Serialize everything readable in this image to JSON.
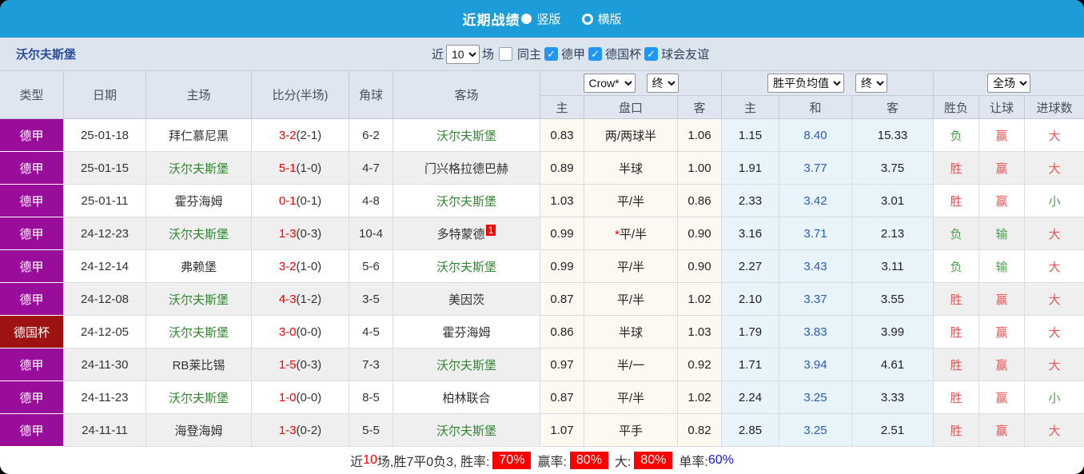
{
  "colors": {
    "accent_blue": "#1c9cd8",
    "league_purple": "#990d9b",
    "cup_red": "#9e1212",
    "win_red": "#f15353",
    "lose_green": "#4ca04c",
    "self_team_green": "#308830",
    "score_red": "#ff0000",
    "avg_draw_blue": "#2a5db8",
    "team_link_blue": "#2b4d9e",
    "rate_badge_red": "#ff0000",
    "single_rate_blue": "#1414e6"
  },
  "topbar": {
    "title": "近期战绩",
    "vertical_label": "竖版",
    "horizontal_label": "横版",
    "selected_layout": "竖版"
  },
  "filterbar": {
    "team": "沃尔夫斯堡",
    "near_label": "近",
    "count": "10",
    "games_label": "场",
    "same_home_label": "同主",
    "leagues": [
      "德甲",
      "德国杯",
      "球会友谊"
    ],
    "check_icon": "✓"
  },
  "table": {
    "selects": {
      "odds_source": "Crow*",
      "odds_time": "终",
      "avg_type": "胜平负均值",
      "avg_time": "终",
      "scope": "全场"
    },
    "columns": [
      "类型",
      "日期",
      "主场",
      "比分(半场)",
      "角球",
      "客场"
    ],
    "subcolumns": [
      "主",
      "盘口",
      "客",
      "主",
      "和",
      "客",
      "胜负",
      "让球",
      "进球数"
    ],
    "rows": [
      {
        "type": "德甲",
        "kind": "league",
        "date": "25-01-18",
        "home": {
          "text": "拜仁慕尼黑",
          "self": false
        },
        "score": "3-2",
        "half": "(2-1)",
        "corners": "6-2",
        "away": {
          "text": "沃尔夫斯堡",
          "self": true,
          "badge": ""
        },
        "odds": {
          "home": "0.83",
          "handicap": "两/两球半",
          "mark": "",
          "away": "1.06"
        },
        "avg": {
          "home": "1.15",
          "draw": "8.40",
          "away": "15.33"
        },
        "outcomes": [
          {
            "text": "负",
            "tone": "green"
          },
          {
            "text": "赢",
            "tone": "red"
          },
          {
            "text": "大",
            "tone": "red"
          }
        ]
      },
      {
        "type": "德甲",
        "kind": "league",
        "date": "25-01-15",
        "home": {
          "text": "沃尔夫斯堡",
          "self": true
        },
        "score": "5-1",
        "half": "(1-0)",
        "corners": "4-7",
        "away": {
          "text": "门兴格拉德巴赫",
          "self": false,
          "badge": ""
        },
        "odds": {
          "home": "0.89",
          "handicap": "半球",
          "mark": "",
          "away": "1.00"
        },
        "avg": {
          "home": "1.91",
          "draw": "3.77",
          "away": "3.75"
        },
        "outcomes": [
          {
            "text": "胜",
            "tone": "red"
          },
          {
            "text": "赢",
            "tone": "red"
          },
          {
            "text": "大",
            "tone": "red"
          }
        ]
      },
      {
        "type": "德甲",
        "kind": "league",
        "date": "25-01-11",
        "home": {
          "text": "霍芬海姆",
          "self": false
        },
        "score": "0-1",
        "half": "(0-1)",
        "corners": "4-8",
        "away": {
          "text": "沃尔夫斯堡",
          "self": true,
          "badge": ""
        },
        "odds": {
          "home": "1.03",
          "handicap": "平/半",
          "mark": "",
          "away": "0.86"
        },
        "avg": {
          "home": "2.33",
          "draw": "3.42",
          "away": "3.01"
        },
        "outcomes": [
          {
            "text": "胜",
            "tone": "red"
          },
          {
            "text": "赢",
            "tone": "red"
          },
          {
            "text": "小",
            "tone": "green"
          }
        ]
      },
      {
        "type": "德甲",
        "kind": "league",
        "date": "24-12-23",
        "home": {
          "text": "沃尔夫斯堡",
          "self": true
        },
        "score": "1-3",
        "half": "(0-3)",
        "corners": "10-4",
        "away": {
          "text": "多特蒙德",
          "self": false,
          "badge": "1"
        },
        "odds": {
          "home": "0.99",
          "handicap": "平/半",
          "mark": "*",
          "away": "0.90"
        },
        "avg": {
          "home": "3.16",
          "draw": "3.71",
          "away": "2.13"
        },
        "outcomes": [
          {
            "text": "负",
            "tone": "green"
          },
          {
            "text": "输",
            "tone": "green"
          },
          {
            "text": "大",
            "tone": "red"
          }
        ]
      },
      {
        "type": "德甲",
        "kind": "league",
        "date": "24-12-14",
        "home": {
          "text": "弗赖堡",
          "self": false
        },
        "score": "3-2",
        "half": "(1-0)",
        "corners": "5-6",
        "away": {
          "text": "沃尔夫斯堡",
          "self": true,
          "badge": ""
        },
        "odds": {
          "home": "0.99",
          "handicap": "平/半",
          "mark": "",
          "away": "0.90"
        },
        "avg": {
          "home": "2.27",
          "draw": "3.43",
          "away": "3.11"
        },
        "outcomes": [
          {
            "text": "负",
            "tone": "green"
          },
          {
            "text": "输",
            "tone": "green"
          },
          {
            "text": "大",
            "tone": "red"
          }
        ]
      },
      {
        "type": "德甲",
        "kind": "league",
        "date": "24-12-08",
        "home": {
          "text": "沃尔夫斯堡",
          "self": true
        },
        "score": "4-3",
        "half": "(1-2)",
        "corners": "3-5",
        "away": {
          "text": "美因茨",
          "self": false,
          "badge": ""
        },
        "odds": {
          "home": "0.87",
          "handicap": "平/半",
          "mark": "",
          "away": "1.02"
        },
        "avg": {
          "home": "2.10",
          "draw": "3.37",
          "away": "3.55"
        },
        "outcomes": [
          {
            "text": "胜",
            "tone": "red"
          },
          {
            "text": "赢",
            "tone": "red"
          },
          {
            "text": "大",
            "tone": "red"
          }
        ]
      },
      {
        "type": "德国杯",
        "kind": "cup",
        "date": "24-12-05",
        "home": {
          "text": "沃尔夫斯堡",
          "self": true
        },
        "score": "3-0",
        "half": "(0-0)",
        "corners": "4-5",
        "away": {
          "text": "霍芬海姆",
          "self": false,
          "badge": ""
        },
        "odds": {
          "home": "0.86",
          "handicap": "半球",
          "mark": "",
          "away": "1.03"
        },
        "avg": {
          "home": "1.79",
          "draw": "3.83",
          "away": "3.99"
        },
        "outcomes": [
          {
            "text": "胜",
            "tone": "red"
          },
          {
            "text": "赢",
            "tone": "red"
          },
          {
            "text": "大",
            "tone": "red"
          }
        ]
      },
      {
        "type": "德甲",
        "kind": "league",
        "date": "24-11-30",
        "home": {
          "text": "RB莱比锡",
          "self": false
        },
        "score": "1-5",
        "half": "(0-3)",
        "corners": "7-3",
        "away": {
          "text": "沃尔夫斯堡",
          "self": true,
          "badge": ""
        },
        "odds": {
          "home": "0.97",
          "handicap": "半/一",
          "mark": "",
          "away": "0.92"
        },
        "avg": {
          "home": "1.71",
          "draw": "3.94",
          "away": "4.61"
        },
        "outcomes": [
          {
            "text": "胜",
            "tone": "red"
          },
          {
            "text": "赢",
            "tone": "red"
          },
          {
            "text": "大",
            "tone": "red"
          }
        ]
      },
      {
        "type": "德甲",
        "kind": "league",
        "date": "24-11-23",
        "home": {
          "text": "沃尔夫斯堡",
          "self": true
        },
        "score": "1-0",
        "half": "(0-0)",
        "corners": "8-5",
        "away": {
          "text": "柏林联合",
          "self": false,
          "badge": ""
        },
        "odds": {
          "home": "0.87",
          "handicap": "平/半",
          "mark": "",
          "away": "1.02"
        },
        "avg": {
          "home": "2.24",
          "draw": "3.25",
          "away": "3.33"
        },
        "outcomes": [
          {
            "text": "胜",
            "tone": "red"
          },
          {
            "text": "赢",
            "tone": "red"
          },
          {
            "text": "小",
            "tone": "green"
          }
        ]
      },
      {
        "type": "德甲",
        "kind": "league",
        "date": "24-11-11",
        "home": {
          "text": "海登海姆",
          "self": false
        },
        "score": "1-3",
        "half": "(0-2)",
        "corners": "5-5",
        "away": {
          "text": "沃尔夫斯堡",
          "self": true,
          "badge": ""
        },
        "odds": {
          "home": "1.07",
          "handicap": "平手",
          "mark": "",
          "away": "0.82"
        },
        "avg": {
          "home": "2.85",
          "draw": "3.25",
          "away": "2.51"
        },
        "outcomes": [
          {
            "text": "胜",
            "tone": "red"
          },
          {
            "text": "赢",
            "tone": "red"
          },
          {
            "text": "大",
            "tone": "red"
          }
        ]
      }
    ]
  },
  "footer": {
    "near_label": "近",
    "count": "10",
    "mid_text": "场,胜7平0负3, 胜率:",
    "win_rate": "70%",
    "handicap_label": "赢率:",
    "handicap_rate": "80%",
    "big_label": "大:",
    "big_rate": "80%",
    "single_label": "单率:",
    "single_rate": "60%"
  }
}
